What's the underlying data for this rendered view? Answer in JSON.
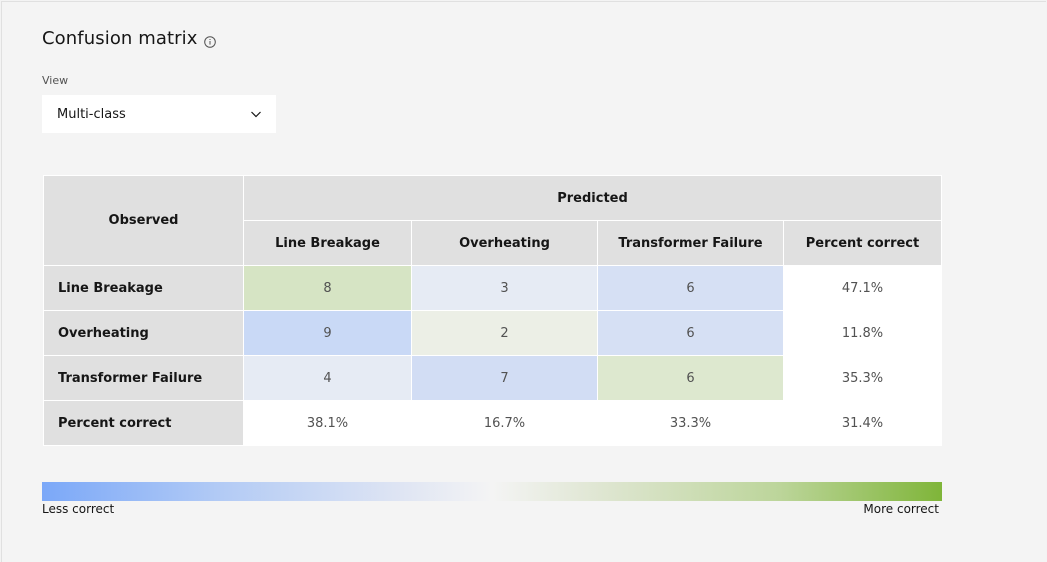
{
  "title": "Confusion matrix",
  "view": {
    "label": "View",
    "selected": "Multi-class"
  },
  "matrix": {
    "observed_header": "Observed",
    "predicted_header": "Predicted",
    "columns": [
      "Line Breakage",
      "Overheating",
      "Transformer Failure",
      "Percent correct"
    ],
    "rows": [
      {
        "label": "Line Breakage",
        "cells": [
          "8",
          "3",
          "6"
        ],
        "percent": "47.1%"
      },
      {
        "label": "Overheating",
        "cells": [
          "9",
          "2",
          "6"
        ],
        "percent": "11.8%"
      },
      {
        "label": "Transformer Failure",
        "cells": [
          "4",
          "7",
          "6"
        ],
        "percent": "35.3%"
      }
    ],
    "totals": {
      "label": "Percent correct",
      "cells": [
        "38.1%",
        "16.7%",
        "33.3%"
      ],
      "overall": "31.4%"
    },
    "cell_colors": [
      [
        "#d6e4c4",
        "#e6ebf4",
        "#d6e0f4"
      ],
      [
        "#c9d9f6",
        "#ecefe6",
        "#d6e0f4"
      ],
      [
        "#e6ebf4",
        "#d2ddf4",
        "#dde8cf"
      ]
    ]
  },
  "legend": {
    "low": "Less correct",
    "high": "More correct",
    "low_color": "#7ba8f8",
    "high_color": "#7fb539"
  }
}
